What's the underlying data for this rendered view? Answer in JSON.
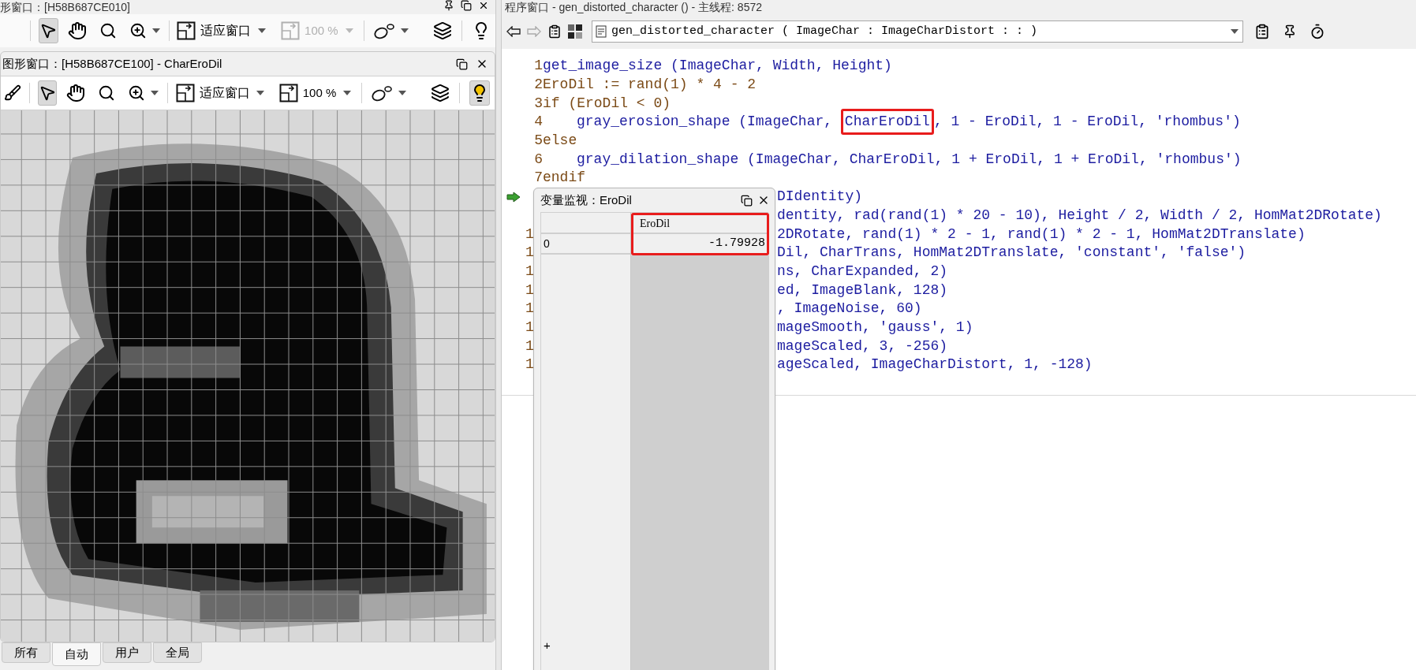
{
  "left_panel": {
    "back_window": {
      "title": "形窗口：[H58B687CE010]",
      "toolbar": {
        "fit_label": "适应窗口",
        "zoom_label": "100 %",
        "zoom_disabled": true,
        "lamp_on": false
      }
    },
    "graphics_window": {
      "title": "图形窗口：[H58B687CE100] - CharEroDil",
      "toolbar": {
        "fit_label": "适应窗口",
        "zoom_label": "100 %",
        "zoom_disabled": false,
        "lamp_on": true,
        "show_broom": true
      }
    },
    "tabs": [
      {
        "label": "所有",
        "selected": false
      },
      {
        "label": "自动",
        "selected": true
      },
      {
        "label": "用户",
        "selected": false
      },
      {
        "label": "全局",
        "selected": false
      }
    ]
  },
  "program_window": {
    "title": "程序窗口 - gen_distorted_character () - 主线程: 8572",
    "procedure": "gen_distorted_character ( ImageChar : ImageCharDistort : : )",
    "lines": [
      {
        "number": "1",
        "kind": "call",
        "text": "get_image_size (ImageChar, Width, Height)"
      },
      {
        "number": "2",
        "kind": "control",
        "text": "EroDil := rand(1) * 4 - 2"
      },
      {
        "number": "3",
        "kind": "control",
        "text": "if (EroDil < 0)",
        "children": [
          {
            "number": "4",
            "kind": "call",
            "parts": [
              {
                "text": "gray_erosion_shape (ImageChar, ",
                "boxed": false
              },
              {
                "text": "CharEroDil",
                "boxed": true
              },
              {
                "text": ", 1 - EroDil, 1 - EroDil, 'rhombus')",
                "boxed": false
              }
            ]
          }
        ]
      },
      {
        "number": "5",
        "kind": "control",
        "text": "else",
        "children": [
          {
            "number": "6",
            "kind": "call",
            "text": "gray_dilation_shape (ImageChar, CharEroDil, 1 + EroDil, 1 + EroDil, 'rhombus')"
          }
        ]
      },
      {
        "number": "7",
        "kind": "control",
        "text": "endif"
      }
    ],
    "covered_lines": [
      {
        "current": true,
        "text": "DIdentity)"
      },
      {
        "current": false,
        "text": "dentity, rad(rand(1) * 20 - 10), Height / 2, Width / 2, HomMat2DRotate)"
      },
      {
        "current": false,
        "number": "1",
        "text": "2DRotate, rand(1) * 2 - 1, rand(1) * 2 - 1, HomMat2DTranslate)"
      },
      {
        "current": false,
        "number": "1",
        "text": "Dil, CharTrans, HomMat2DTranslate, 'constant', 'false')"
      },
      {
        "current": false,
        "number": "1",
        "text": "ns, CharExpanded, 2)"
      },
      {
        "current": false,
        "number": "1",
        "text": "ed, ImageBlank, 128)"
      },
      {
        "current": false,
        "number": "1",
        "text": ", ImageNoise, 60)"
      },
      {
        "current": false,
        "number": "1",
        "text": "mageSmooth, 'gauss', 1)"
      },
      {
        "current": false,
        "number": "1",
        "text": "mageScaled, 3, -256)"
      },
      {
        "current": false,
        "number": "1",
        "text": "ageScaled, ImageCharDistort, 1, -128)"
      }
    ]
  },
  "watch_window": {
    "title": "变量监视：EroDil",
    "column": "EroDil",
    "highlighted": true,
    "rows": [
      {
        "index": "0",
        "value": "-1.79928"
      }
    ],
    "add_label": "+"
  }
}
